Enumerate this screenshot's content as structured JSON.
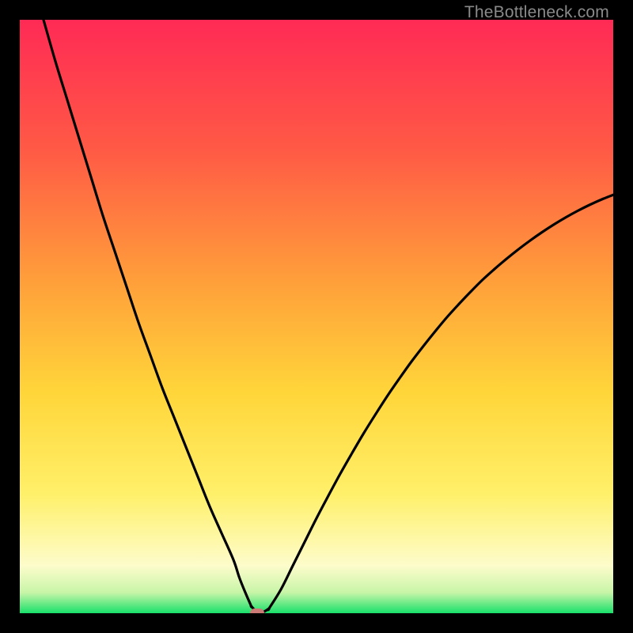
{
  "watermark": "TheBottleneck.com",
  "colors": {
    "top": "#ff2a55",
    "upper_mid": "#ff8a3a",
    "mid": "#ffd63a",
    "lower_mid": "#fff06a",
    "pale": "#fdfccb",
    "green": "#18e06a",
    "curve": "#000000",
    "marker": "#cb7a76",
    "frame": "#000000"
  },
  "chart_data": {
    "type": "line",
    "title": "",
    "xlabel": "",
    "ylabel": "",
    "xlim": [
      0,
      100
    ],
    "ylim": [
      0,
      100
    ],
    "marker": {
      "x": 40,
      "y": 0
    },
    "series": [
      {
        "name": "left-branch",
        "x": [
          4,
          6,
          8,
          10,
          12,
          14,
          16,
          18,
          20,
          22,
          24,
          26,
          28,
          30,
          32,
          34,
          36,
          37,
          38,
          39
        ],
        "y": [
          100,
          93,
          86.5,
          80,
          73.5,
          67,
          61,
          55,
          49,
          43.5,
          38,
          33,
          28,
          23,
          18,
          13.5,
          9,
          6,
          3.5,
          1.2
        ]
      },
      {
        "name": "floor",
        "x": [
          39,
          40,
          41,
          42
        ],
        "y": [
          1.2,
          0.2,
          0.2,
          0.8
        ]
      },
      {
        "name": "right-branch",
        "x": [
          42,
          44,
          46,
          48,
          50,
          52,
          54,
          56,
          58,
          60,
          62,
          64,
          66,
          68,
          70,
          72,
          74,
          76,
          78,
          80,
          82,
          84,
          86,
          88,
          90,
          92,
          94,
          96,
          98,
          100
        ],
        "y": [
          0.8,
          4,
          8,
          12,
          16,
          19.8,
          23.5,
          27,
          30.4,
          33.6,
          36.7,
          39.6,
          42.4,
          45,
          47.5,
          49.9,
          52.1,
          54.2,
          56.2,
          58,
          59.7,
          61.3,
          62.8,
          64.2,
          65.5,
          66.7,
          67.8,
          68.8,
          69.7,
          70.5
        ]
      }
    ],
    "gradient_stops": [
      {
        "pos": 0.0,
        "color": "#ff2a55"
      },
      {
        "pos": 0.22,
        "color": "#ff5a45"
      },
      {
        "pos": 0.45,
        "color": "#ffa23a"
      },
      {
        "pos": 0.63,
        "color": "#ffd63a"
      },
      {
        "pos": 0.8,
        "color": "#fff06a"
      },
      {
        "pos": 0.92,
        "color": "#fdfccb"
      },
      {
        "pos": 0.965,
        "color": "#c8f5a8"
      },
      {
        "pos": 1.0,
        "color": "#18e06a"
      }
    ]
  }
}
